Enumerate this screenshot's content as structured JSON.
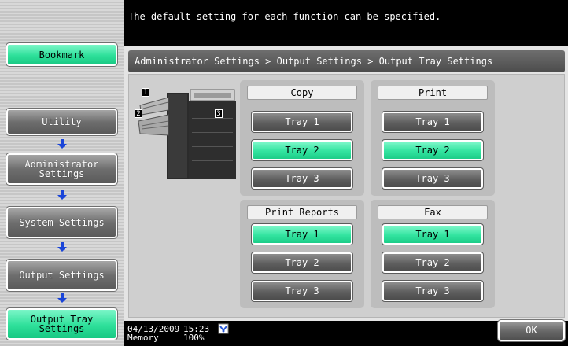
{
  "header": {
    "message": "The default setting for each function can be specified."
  },
  "sidebar": {
    "bookmark": "Bookmark",
    "items": [
      {
        "label": "Utility"
      },
      {
        "label": "Administrator\nSettings"
      },
      {
        "label": "System Settings"
      },
      {
        "label": "Output Settings"
      },
      {
        "label": "Output Tray\nSettings"
      }
    ]
  },
  "breadcrumb": "Administrator Settings > Output Settings > Output Tray Settings",
  "machine": {
    "tray_labels": [
      "1",
      "2",
      "3"
    ]
  },
  "groups": {
    "copy": {
      "title": "Copy",
      "trays": [
        "Tray 1",
        "Tray 2",
        "Tray 3"
      ],
      "selected": "Tray 2"
    },
    "print": {
      "title": "Print",
      "trays": [
        "Tray 1",
        "Tray 2",
        "Tray 3"
      ],
      "selected": "Tray 2"
    },
    "print_reports": {
      "title": "Print Reports",
      "trays": [
        "Tray 1",
        "Tray 2",
        "Tray 3"
      ],
      "selected": "Tray 1"
    },
    "fax": {
      "title": "Fax",
      "trays": [
        "Tray 1",
        "Tray 2",
        "Tray 3"
      ],
      "selected": "Tray 1"
    }
  },
  "status": {
    "date": "04/13/2009",
    "memory_label": "Memory",
    "time": "15:23",
    "memory_value": "100%",
    "icon": "network-icon"
  },
  "ok_label": "OK",
  "colors": {
    "selected_green": "#2ee09a",
    "button_gray": "#5f5f5f",
    "background_black": "#000000"
  }
}
